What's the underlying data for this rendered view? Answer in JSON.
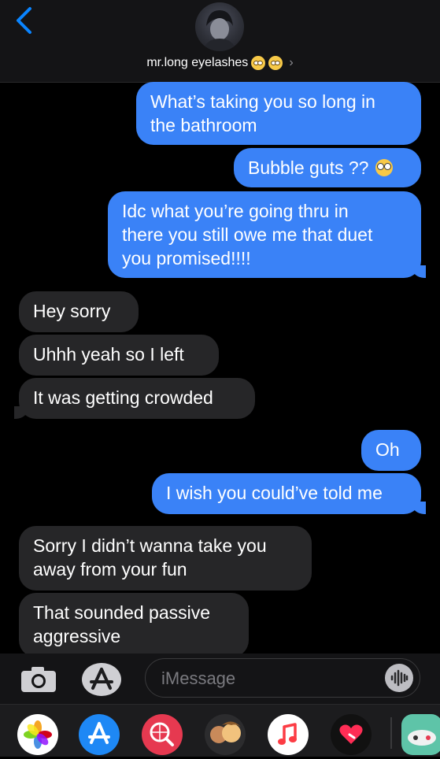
{
  "header": {
    "contact_name": "mr.long eyelashes",
    "chevron": "›"
  },
  "messages": [
    {
      "from": "me",
      "lines": [
        "What’s taking you so long in",
        "the bathroom"
      ]
    },
    {
      "from": "me",
      "text": "Bubble guts ??"
    },
    {
      "from": "me",
      "lines": [
        "Idc what you’re going thru in",
        "there you still owe me that duet",
        "you promised!!!!"
      ]
    },
    {
      "from": "them",
      "text": "Hey sorry"
    },
    {
      "from": "them",
      "text": "Uhhh yeah so I left"
    },
    {
      "from": "them",
      "text": "It was getting crowded"
    },
    {
      "from": "me",
      "text": "Oh"
    },
    {
      "from": "me",
      "text": "I wish you could’ve told me"
    },
    {
      "from": "them",
      "lines": [
        "Sorry I didn’t wanna take you",
        "away from your fun"
      ]
    },
    {
      "from": "them",
      "lines": [
        "That sounded passive",
        "aggressive"
      ]
    }
  ],
  "input": {
    "placeholder": "iMessage"
  },
  "icons": {
    "back": "chevron-left-icon",
    "camera": "camera-icon",
    "app_store": "app-store-icon",
    "audio": "audio-waveform-icon",
    "drawer": [
      "photos-icon",
      "app-store-icon",
      "web-search-icon",
      "memoji-icon",
      "music-icon",
      "digital-touch-icon",
      "game-icon"
    ]
  },
  "colors": {
    "outgoing": "#3a82f7",
    "incoming": "#262628",
    "accent": "#0a84ff"
  }
}
